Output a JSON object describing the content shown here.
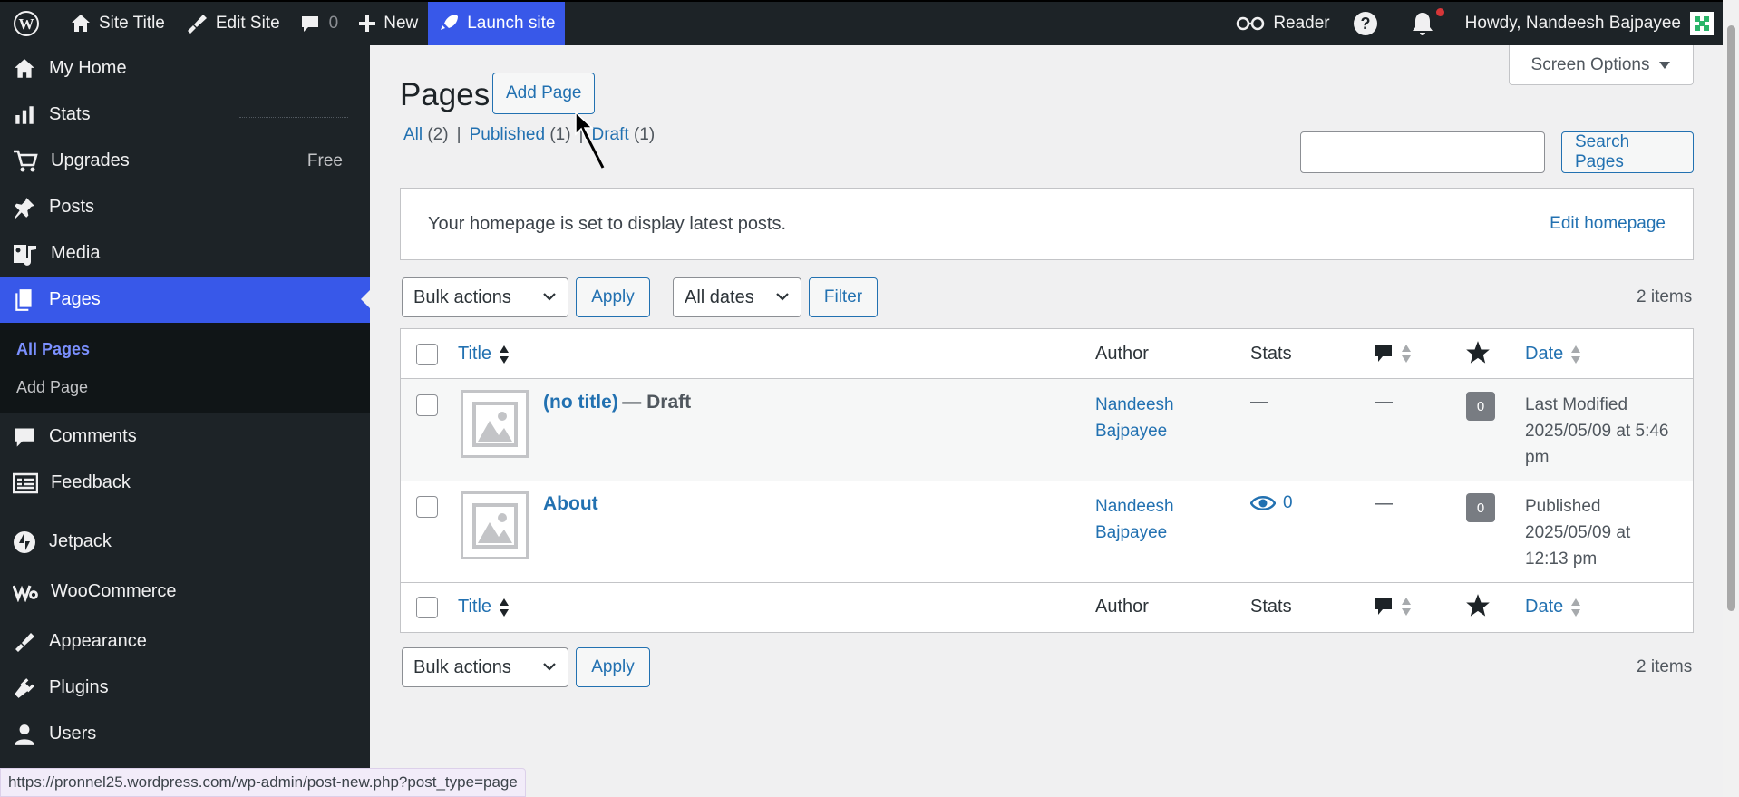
{
  "adminbar": {
    "site_title": "Site Title",
    "edit_site": "Edit Site",
    "comments_count": "0",
    "new": "New",
    "launch_site": "Launch site",
    "reader": "Reader",
    "howdy": "Howdy, Nandeesh Bajpayee"
  },
  "sidebar": {
    "items": [
      {
        "label": "My Home",
        "icon": "home-icon"
      },
      {
        "label": "Stats",
        "icon": "stats-icon"
      },
      {
        "label": "Upgrades",
        "badge": "Free",
        "icon": "cart-icon"
      },
      {
        "label": "Posts",
        "icon": "pin-icon"
      },
      {
        "label": "Media",
        "icon": "media-icon"
      },
      {
        "label": "Pages",
        "icon": "pages-icon"
      },
      {
        "label": "Comments",
        "icon": "comment-icon"
      },
      {
        "label": "Feedback",
        "icon": "feedback-icon"
      },
      {
        "label": "Jetpack",
        "icon": "jetpack-icon"
      },
      {
        "label": "WooCommerce",
        "icon": "woo-icon"
      },
      {
        "label": "Appearance",
        "icon": "brush-icon"
      },
      {
        "label": "Plugins",
        "icon": "plugin-icon"
      },
      {
        "label": "Users",
        "icon": "users-icon"
      }
    ],
    "submenu": [
      "All Pages",
      "Add Page"
    ]
  },
  "main": {
    "title": "Pages",
    "add_page": "Add Page",
    "screen_options": "Screen Options",
    "filters": {
      "all": "All",
      "all_count": "(2)",
      "published": "Published",
      "published_count": "(1)",
      "draft": "Draft",
      "draft_count": "(1)"
    },
    "search_button": "Search Pages",
    "notice": "Your homepage is set to display latest posts.",
    "edit_homepage": "Edit homepage",
    "bulk_actions": "Bulk actions",
    "apply": "Apply",
    "all_dates": "All dates",
    "filter": "Filter",
    "items_count": "2 items",
    "columns": {
      "title": "Title",
      "author": "Author",
      "stats": "Stats",
      "date": "Date"
    },
    "rows": [
      {
        "title": "(no title)",
        "state": "— Draft",
        "author_first": "Nandeesh",
        "author_last": "Bajpayee",
        "stats": "—",
        "comments_dash": "—",
        "comments": "0",
        "date_status": "Last Modified",
        "date_line1": "2025/05/09 at 5:46",
        "date_line2": "pm"
      },
      {
        "title": "About",
        "state": "",
        "author_first": "Nandeesh",
        "author_last": "Bajpayee",
        "stats": "0",
        "comments_dash": "—",
        "comments": "0",
        "date_status": "Published",
        "date_line1": "2025/05/09 at",
        "date_line2": "12:13 pm"
      }
    ]
  },
  "statusbar": {
    "url": "https://pronnel25.wordpress.com/wp-admin/post-new.php?post_type=page"
  },
  "colors": {
    "accent": "#3858e9",
    "link": "#2271b1",
    "adminbar": "#1d2327"
  }
}
